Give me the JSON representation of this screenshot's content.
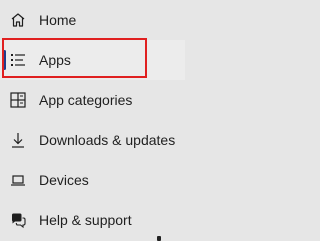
{
  "nav": {
    "items": [
      {
        "label": "Home",
        "icon": "home-icon"
      },
      {
        "label": "Apps",
        "icon": "apps-list-icon",
        "selected": true
      },
      {
        "label": "App categories",
        "icon": "app-categories-icon"
      },
      {
        "label": "Downloads & updates",
        "icon": "download-icon"
      },
      {
        "label": "Devices",
        "icon": "laptop-icon"
      },
      {
        "label": "Help & support",
        "icon": "help-chat-icon"
      }
    ]
  },
  "colors": {
    "background": "#e6e6e6",
    "selected_indicator": "#1f3b8a",
    "highlight_box": "#e02020"
  }
}
